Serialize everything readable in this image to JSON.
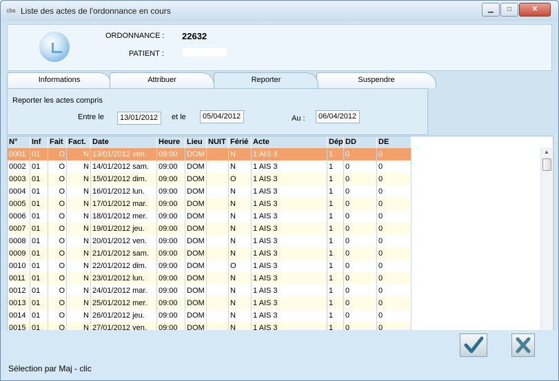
{
  "window": {
    "app_icon_text": "cba",
    "title": "Liste des actes de l'ordonnance en cours",
    "minimize_glyph": "▁",
    "maximize_glyph": "□",
    "close_glyph": "✕"
  },
  "header": {
    "ordonnance_label": "ORDONNANCE :",
    "ordonnance_value": "22632",
    "patient_label": "PATIENT :",
    "patient_value": ""
  },
  "tabs": [
    {
      "label": "Informations",
      "active": false
    },
    {
      "label": "Attribuer",
      "active": false
    },
    {
      "label": "Reporter",
      "active": true
    },
    {
      "label": "Suspendre",
      "active": false
    }
  ],
  "reporter": {
    "heading": "Reporter les actes compris",
    "between_label": "Entre le",
    "between_value": "13/01/2012",
    "and_label": "et le",
    "and_value": "05/04/2012",
    "to_label": "Au :",
    "to_value": "06/04/2012"
  },
  "table": {
    "columns": [
      "N°",
      "Inf",
      "Fait",
      "Fact.",
      "Date",
      "Heure",
      "Lieu",
      "NUIT",
      "Férié",
      "Acte",
      "Dép",
      "DD",
      "DE"
    ],
    "rows": [
      [
        "0001",
        "01",
        "O",
        "N",
        "13/01/2012 ven.",
        "09:00",
        "DOM",
        "",
        "N",
        "1  AIS   3",
        "1",
        "0",
        "0"
      ],
      [
        "0002",
        "01",
        "O",
        "N",
        "14/01/2012 sam.",
        "09:00",
        "DOM",
        "",
        "N",
        "1  AIS   3",
        "1",
        "0",
        "0"
      ],
      [
        "0003",
        "01",
        "O",
        "N",
        "15/01/2012 dim.",
        "09:00",
        "DOM",
        "",
        "O",
        "1  AIS   3",
        "1",
        "0",
        "0"
      ],
      [
        "0004",
        "01",
        "O",
        "N",
        "16/01/2012 lun.",
        "09:00",
        "DOM",
        "",
        "N",
        "1  AIS   3",
        "1",
        "0",
        "0"
      ],
      [
        "0005",
        "01",
        "O",
        "N",
        "17/01/2012 mar.",
        "09:00",
        "DOM",
        "",
        "N",
        "1  AIS   3",
        "1",
        "0",
        "0"
      ],
      [
        "0006",
        "01",
        "O",
        "N",
        "18/01/2012 mer.",
        "09:00",
        "DOM",
        "",
        "N",
        "1  AIS   3",
        "1",
        "0",
        "0"
      ],
      [
        "0007",
        "01",
        "O",
        "N",
        "19/01/2012 jeu.",
        "09:00",
        "DOM",
        "",
        "N",
        "1  AIS   3",
        "1",
        "0",
        "0"
      ],
      [
        "0008",
        "01",
        "O",
        "N",
        "20/01/2012 ven.",
        "09:00",
        "DOM",
        "",
        "N",
        "1  AIS   3",
        "1",
        "0",
        "0"
      ],
      [
        "0009",
        "01",
        "O",
        "N",
        "21/01/2012 sam.",
        "09:00",
        "DOM",
        "",
        "N",
        "1  AIS   3",
        "1",
        "0",
        "0"
      ],
      [
        "0010",
        "01",
        "O",
        "N",
        "22/01/2012 dim.",
        "09:00",
        "DOM",
        "",
        "O",
        "1  AIS   3",
        "1",
        "0",
        "0"
      ],
      [
        "0011",
        "01",
        "O",
        "N",
        "23/01/2012 lun.",
        "09:00",
        "DOM",
        "",
        "N",
        "1  AIS   3",
        "1",
        "0",
        "0"
      ],
      [
        "0012",
        "01",
        "O",
        "N",
        "24/01/2012 mar.",
        "09:00",
        "DOM",
        "",
        "N",
        "1  AIS   3",
        "1",
        "0",
        "0"
      ],
      [
        "0013",
        "01",
        "O",
        "N",
        "25/01/2012 mer.",
        "09:00",
        "DOM",
        "",
        "N",
        "1  AIS   3",
        "1",
        "0",
        "0"
      ],
      [
        "0014",
        "01",
        "O",
        "N",
        "26/01/2012 jeu.",
        "09:00",
        "DOM",
        "",
        "N",
        "1  AIS   3",
        "1",
        "0",
        "0"
      ],
      [
        "0015",
        "01",
        "O",
        "N",
        "27/01/2012 ven.",
        "09:00",
        "DOM",
        "",
        "N",
        "1  AIS   3",
        "1",
        "0",
        "0"
      ]
    ],
    "selected_row": 0
  },
  "scrollbar": {
    "up_glyph": "▲"
  },
  "actions": {
    "validate_icon": "checkmark-icon",
    "cancel_icon": "cross-icon"
  },
  "status": {
    "text": "Sélection par Maj - clic"
  },
  "colors": {
    "selected_row": "#f4a06a",
    "alt_row": "#fffde6",
    "window_bg": "#cfe3f1",
    "validate": "#2f6f8c",
    "cancel": "#4a7f94"
  }
}
